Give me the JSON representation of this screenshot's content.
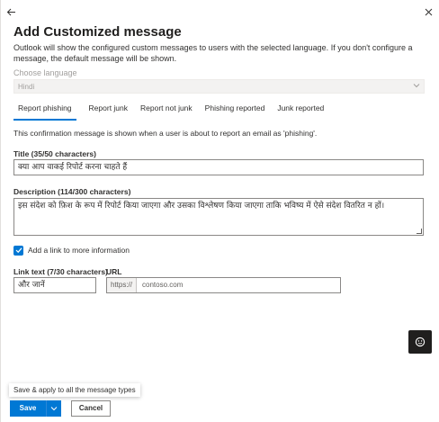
{
  "panel": {
    "title": "Add Customized message",
    "description": "Outlook will show the configured custom messages to users with the selected language. If you don't configure a message, the default message will be shown."
  },
  "language": {
    "label": "Choose language",
    "value": "Hindi"
  },
  "tabs": [
    {
      "label": "Report phishing",
      "active": true
    },
    {
      "label": "Report junk",
      "active": false
    },
    {
      "label": "Report not junk",
      "active": false
    },
    {
      "label": "Phishing reported",
      "active": false
    },
    {
      "label": "Junk reported",
      "active": false
    }
  ],
  "confirmation_text": "This confirmation message is shown when a user is about to report an email as 'phishing'.",
  "title_field": {
    "label": "Title (35/50 characters)",
    "value": "क्या आप वाकई रिपोर्ट करना चाहते हैं"
  },
  "description_field": {
    "label": "Description (114/300 characters)",
    "value": "इस संदेश को फ़िश के रूप में रिपोर्ट किया जाएगा और उसका विश्लेषण किया जाएगा ताकि भविष्य में ऐसे संदेश वितरित न हों।"
  },
  "link_checkbox": {
    "label": "Add a link to more information",
    "checked": true
  },
  "link_text_field": {
    "label": "Link text (7/30 characters)",
    "value": "और जानें"
  },
  "url_field": {
    "label": "URL",
    "prefix": "https://",
    "value": "contoso.com"
  },
  "tooltip": "Save & apply to all the message types",
  "buttons": {
    "save": "Save",
    "cancel": "Cancel"
  },
  "icons": {
    "back": "arrow-left-icon",
    "close": "close-icon",
    "select_chevron": "chevron-down-icon",
    "checkbox": "checkmark-icon",
    "save_menu": "chevron-down-icon",
    "feedback": "feedback-smiley-icon"
  },
  "colors": {
    "accent": "#0078d4",
    "disabled_field_bg": "#f3f2f1",
    "feedback_button_bg": "#201f1e"
  }
}
